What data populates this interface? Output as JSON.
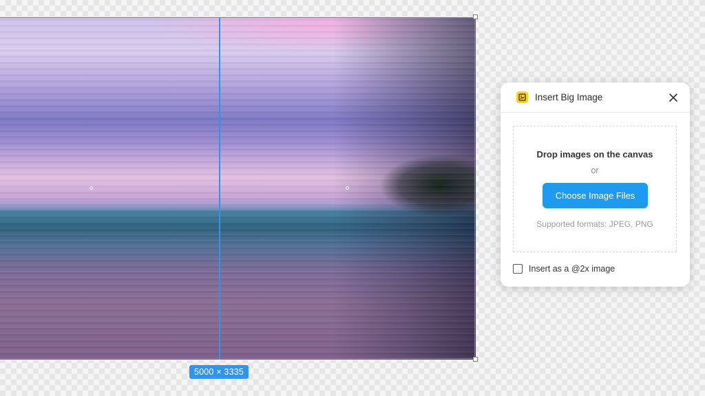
{
  "canvas": {
    "image_dimensions_label": "5000 × 3335",
    "selection_color": "#2d95f0"
  },
  "dialog": {
    "title": "Insert Big Image",
    "app_icon": "insert-big-image-plugin-icon",
    "app_icon_color": "#ffd21f",
    "close_icon": "close-icon",
    "drop_zone": {
      "title": "Drop images on the canvas",
      "or_text": "or",
      "button_label": "Choose Image Files",
      "button_color": "#1e9bf0",
      "supported_formats": "Supported formats: JPEG, PNG"
    },
    "option": {
      "label": "Insert as a @2x image",
      "checked": false
    }
  }
}
